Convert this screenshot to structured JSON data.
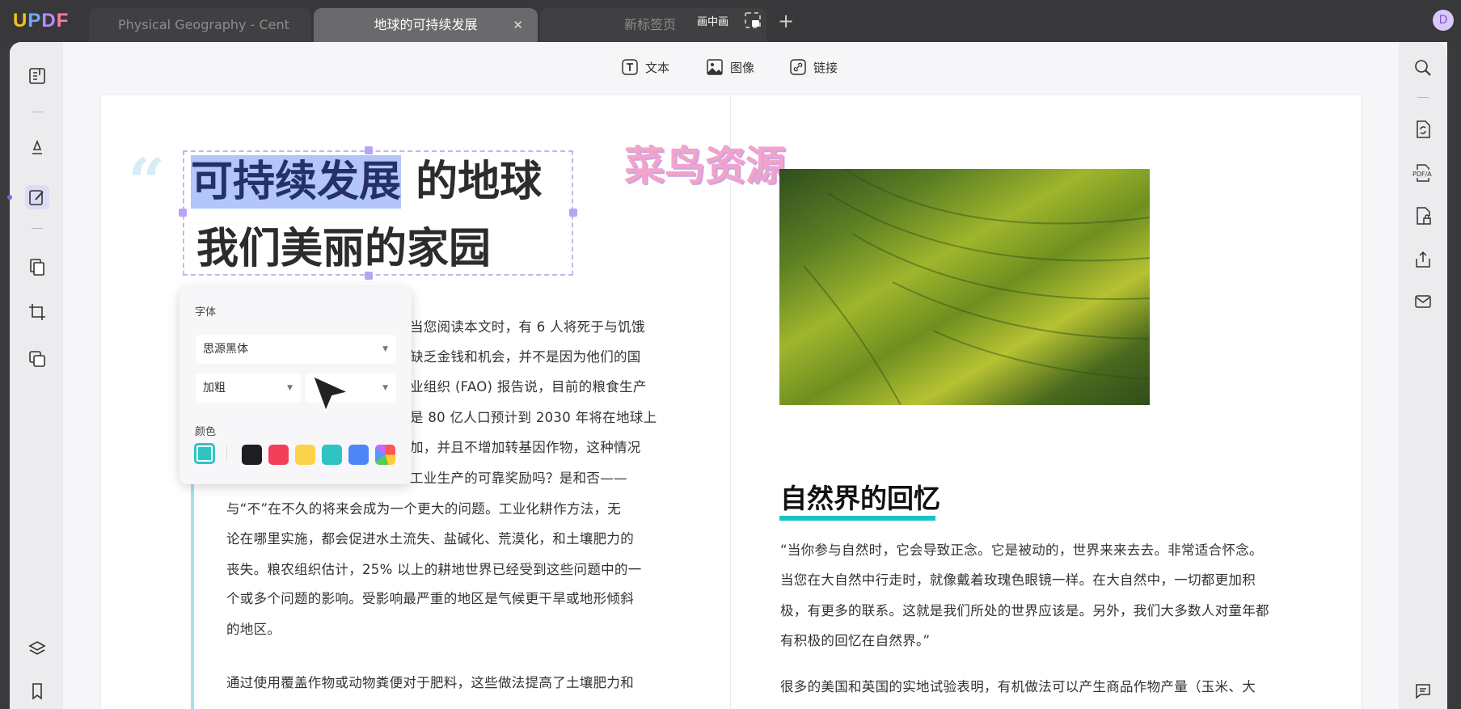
{
  "app": {
    "logo": "UPDF",
    "avatar": "D"
  },
  "tabs": [
    {
      "label": "Physical Geography - Cent"
    },
    {
      "label": "地球的可持续发展",
      "close": "✕"
    },
    {
      "label": "新标签页"
    }
  ],
  "pip": {
    "label": "画中画"
  },
  "toolbar": {
    "text": "文本",
    "image": "图像",
    "link": "链接"
  },
  "watermark": "菜鸟资源",
  "left_page": {
    "quote_mark": "“",
    "title_highlight": "可持续发展",
    "title_rest": " 的地球",
    "title_line2": "我们美丽的家园",
    "fragments": [
      "当您阅读本文时，有 6 人将死于与饥饿",
      "缺乏金钱和机会，并不是因为他们的国",
      "业组织 (FAO) 报告说，目前的粮食生产",
      "是 80 亿人口预计到 2030 年将在地球上",
      "加，并且不增加转基因作物，这种情况",
      "工业生产的可靠奖励吗？是和否——"
    ],
    "lines": [
      "与“不”在不久的将来会成为一个更大的问题。工业化耕作方法，无",
      "论在哪里实施，都会促进水土流失、盐碱化、荒漠化，和土壤肥力的",
      "丧失。粮农组织估计，25% 以上的耕地世界已经受到这些问题中的一",
      "个或多个问题的影响。受影响最严重的地区是气候更干旱或地形倾斜",
      "的地区。"
    ],
    "para2": [
      "通过使用覆盖作物或动物粪便对于肥料，这些做法提高了土壤肥力和"
    ]
  },
  "font_popup": {
    "font_label": "字体",
    "font_family": "思源黑体",
    "font_weight": "加粗",
    "color_label": "颜色",
    "selected_color": "#2ec4c4",
    "swatches": [
      "#1e1e20",
      "#f23f57",
      "#fbd349",
      "#2ec4c4",
      "#4f86f7",
      "multicolor"
    ]
  },
  "right_page": {
    "heading": "自然界的回忆",
    "accent": "#17c2c2",
    "lines": [
      "“当你参与自然时，它会导致正念。它是被动的，世界来来去去。非常适合怀念。",
      "当您在大自然中行走时，就像戴着玫瑰色眼镜一样。在大自然中，一切都更加积",
      "极，有更多的联系。这就是我们所处的世界应该是。另外，我们大多数人对童年都",
      "有积极的回忆在自然界。”"
    ],
    "para2": [
      "很多的美国和英国的实地试验表明，有机做法可以产生商品作物产量（玉米、大"
    ]
  }
}
